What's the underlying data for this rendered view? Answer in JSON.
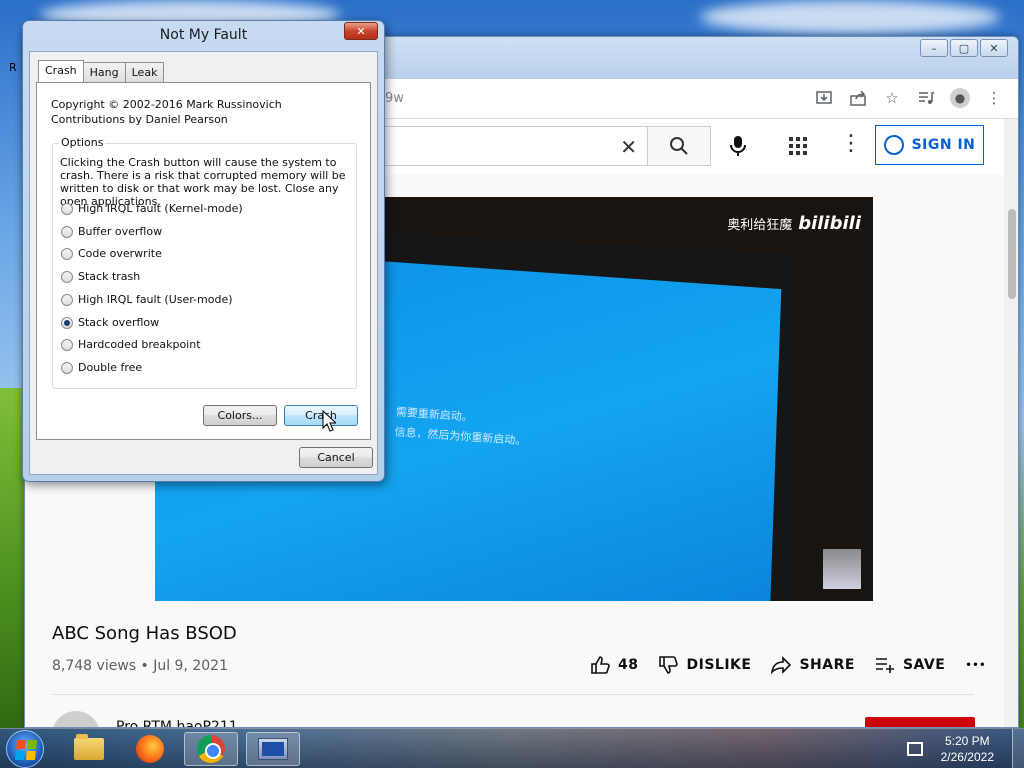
{
  "desktop": {
    "edge_letter": "R"
  },
  "browser": {
    "url_fragment": "9w",
    "window_buttons": [
      "–",
      "▢",
      "✕"
    ]
  },
  "youtube": {
    "search_clear": "✕",
    "sign_in": "SIGN IN",
    "video": {
      "watermark_cn": "奥利给狂魔",
      "watermark_logo": "bilibili",
      "bsod_line1": "需要重新启动。",
      "bsod_line2": "信息，然后为你重新启动。"
    },
    "title": "ABC Song Has BSOD",
    "meta": "8,748 views • Jul 9, 2021",
    "actions": {
      "likes": "48",
      "dislike": "DISLIKE",
      "share": "SHARE",
      "save": "SAVE",
      "more": "•••"
    },
    "channel_name": "Pro RTM haoP211"
  },
  "dialog": {
    "title": "Not My Fault",
    "close": "✕",
    "tabs": [
      "Crash",
      "Hang",
      "Leak"
    ],
    "copyright": "Copyright © 2002-2016 Mark Russinovich",
    "contributions": "Contributions by Daniel Pearson",
    "options_legend": "Options",
    "options_desc": "Clicking the Crash button will cause the system to crash. There is a risk that corrupted memory will be written to disk or that work may be lost. Close any open applications.",
    "radio_options": [
      "High IRQL fault (Kernel-mode)",
      "Buffer overflow",
      "Code overwrite",
      "Stack trash",
      "High IRQL fault (User-mode)",
      "Stack overflow",
      "Hardcoded breakpoint",
      "Double free"
    ],
    "selected_option": "Stack overflow",
    "buttons": {
      "colors": "Colors...",
      "crash": "Crash",
      "cancel": "Cancel"
    }
  },
  "taskbar": {
    "time": "5:20 PM",
    "date": "2/26/2022"
  }
}
